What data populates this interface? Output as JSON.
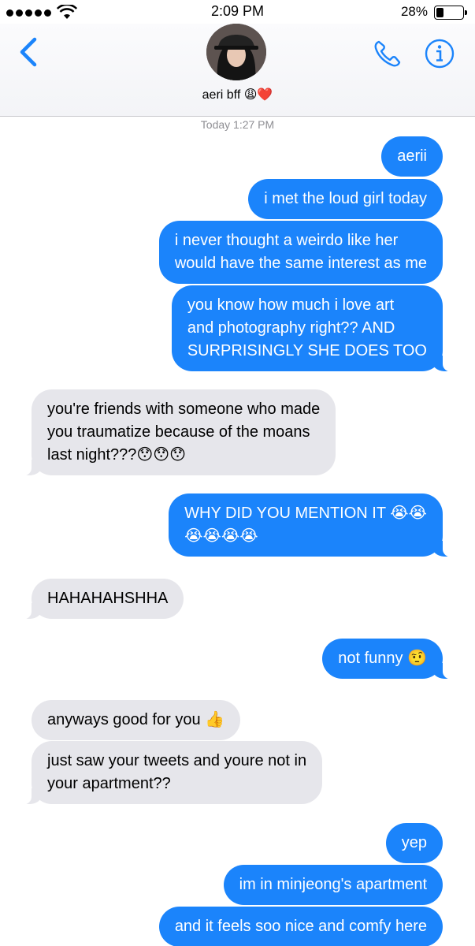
{
  "status_bar": {
    "time": "2:09 PM",
    "battery_percent_label": "28%",
    "battery_level": 0.28,
    "signal_bars": 5
  },
  "header": {
    "contact_name": "aeri bff 😩❤️",
    "back_icon": "chevron-left-icon",
    "call_icon": "phone-icon",
    "info_icon": "info-icon"
  },
  "colors": {
    "sent_bubble": "#1b84fb",
    "received_bubble": "#e6e6eb",
    "accent": "#1b84fb"
  },
  "conversation": {
    "timestamp": "Today 1:27 PM",
    "messages": [
      {
        "from": "me",
        "lines": [
          "aerii"
        ]
      },
      {
        "from": "me",
        "lines": [
          "i met the loud girl today"
        ]
      },
      {
        "from": "me",
        "lines": [
          "i never thought a weirdo like her",
          "would have the same interest as me"
        ]
      },
      {
        "from": "me",
        "lines": [
          "you know how much i love art",
          "and photography right?? AND",
          "SURPRISINGLY SHE DOES TOO"
        ]
      },
      {
        "from": "them",
        "lines": [
          "you're friends with someone who made",
          "you traumatize because of the moans",
          "last night???😯😯😯"
        ]
      },
      {
        "from": "me",
        "lines": [
          "WHY DID YOU MENTION IT 😭😭",
          "😭😭😭😭"
        ]
      },
      {
        "from": "them",
        "lines": [
          "HAHAHAHSHHA"
        ]
      },
      {
        "from": "me",
        "lines": [
          "not funny 🤨"
        ]
      },
      {
        "from": "them",
        "lines": [
          "anyways good for you 👍"
        ]
      },
      {
        "from": "them",
        "lines": [
          "just saw your tweets and youre not in",
          "your apartment??"
        ]
      },
      {
        "from": "me",
        "lines": [
          "yep"
        ]
      },
      {
        "from": "me",
        "lines": [
          "im in minjeong's apartment"
        ]
      },
      {
        "from": "me",
        "lines": [
          "and it feels soo nice and comfy here"
        ]
      }
    ]
  }
}
